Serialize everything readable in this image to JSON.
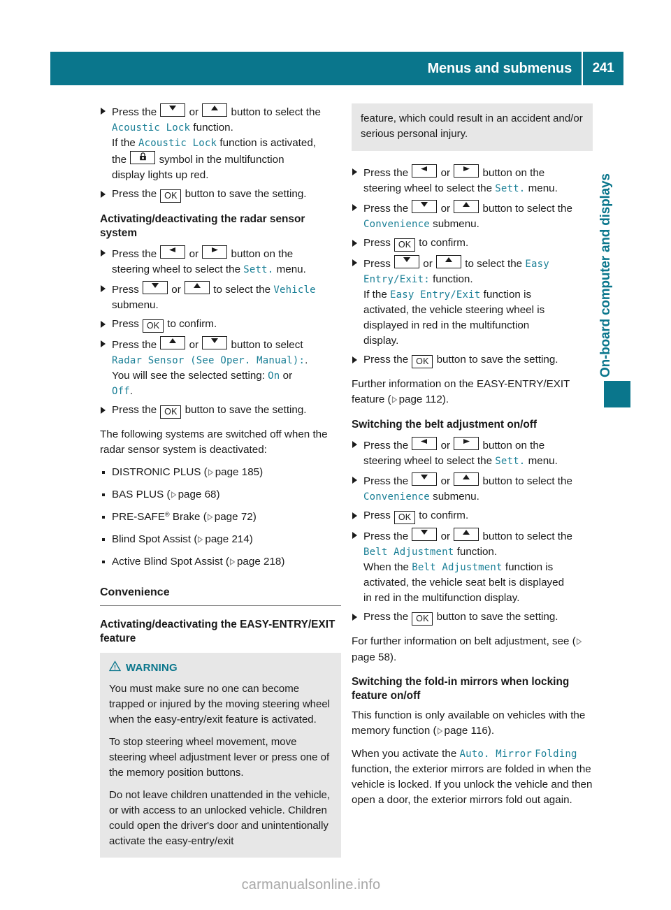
{
  "header": {
    "title": "Menus and submenus",
    "page_number": "241",
    "accent_color": "#0a768c"
  },
  "side_tab": {
    "label": "On-board computer and displays",
    "color": "#0a768c"
  },
  "keys": {
    "down": "down-arrow",
    "up": "up-arrow",
    "left": "left-arrow",
    "right": "right-arrow",
    "ok": "OK",
    "lock": "lock-symbol"
  },
  "left_column": {
    "step_acoustic": {
      "l1_a": "Press the ",
      "l1_or": " or ",
      "l1_b": " button to select the",
      "l2_fn": "Acoustic Lock",
      "l2_tail": " function.",
      "l3_a": "If the ",
      "l3_fn": "Acoustic Lock",
      "l3_tail": " function is activated,",
      "l4_a": "the ",
      "l4_tail": " symbol in the multifunction",
      "l5": "display lights up red."
    },
    "step_save_1": {
      "a": "Press the ",
      "b": " button to save the setting."
    },
    "radar_heading": "Activating/deactivating the radar sensor system",
    "step_radar_1": {
      "a": "Press the ",
      "or": " or ",
      "b": " button on the",
      "l2_a": "steering wheel to select the ",
      "l2_fn": "Sett.",
      "l2_tail": " menu."
    },
    "step_radar_2": {
      "a": "Press ",
      "or": " or ",
      "b": " to select the ",
      "fn": "Vehicle",
      "l2": "submenu."
    },
    "step_radar_3": {
      "a": "Press ",
      "b": " to confirm."
    },
    "step_radar_4": {
      "a": "Press the ",
      "or": " or ",
      "b": " button to select",
      "l2_fn": "Radar Sensor (See Oper. Manual):",
      "l2_tail": ".",
      "l3_a": "You will see the selected setting: ",
      "l3_on": "On",
      "l3_mid": " or",
      "l4_off": "Off",
      "l4_tail": "."
    },
    "step_radar_5": {
      "a": "Press the ",
      "b": " button to save the setting."
    },
    "radar_note": "The following systems are switched off when the radar sensor system is deactivated:",
    "systems_list": [
      {
        "name": "DISTRONIC PLUS",
        "page_prefix": "page",
        "page": "185"
      },
      {
        "name": "BAS PLUS",
        "page_prefix": "page",
        "page": "68"
      },
      {
        "name": "PRE-SAFE® Brake",
        "page_prefix": "page",
        "page": "72",
        "has_sup": true,
        "base": "PRE-SAFE",
        "sup": "®",
        "after": " Brake"
      },
      {
        "name": "Blind Spot Assist",
        "page_prefix": "page",
        "page": "214"
      },
      {
        "name": "Active Blind Spot Assist",
        "page_prefix": "page",
        "page": "218"
      }
    ],
    "convenience_heading": "Convenience",
    "easy_entry_heading": "Activating/deactivating the EASY-ENTRY/EXIT feature",
    "warning": {
      "title": "WARNING",
      "icon": "warning-triangle-icon",
      "paragraphs": [
        "You must make sure no one can become trapped or injured by the moving steering wheel when the easy-entry/exit feature is activated.",
        "To stop steering wheel movement, move steering wheel adjustment lever or press one of the memory position buttons.",
        "Do not leave children unattended in the vehicle, or with access to an unlocked vehicle. Children could open the driver's door and unintentionally activate the easy-entry/exit"
      ]
    }
  },
  "right_column": {
    "warning_continued": "feature, which could result in an accident and/or serious personal injury.",
    "step_ee_1": {
      "a": "Press the ",
      "or": " or ",
      "b": " button on the",
      "l2_a": "steering wheel to select the ",
      "l2_fn": "Sett.",
      "l2_tail": " menu."
    },
    "step_ee_2": {
      "a": "Press the ",
      "or": " or ",
      "b": " button to select the",
      "fn": "Convenience",
      "tail": " submenu."
    },
    "step_ee_3": {
      "a": "Press ",
      "b": " to confirm."
    },
    "step_ee_4": {
      "a": "Press ",
      "or": " or ",
      "b": " to select the ",
      "fn1": "Easy",
      "fn2": "Entry/Exit:",
      "tail": " function.",
      "l3_a": "If the ",
      "l3_fn": "Easy Entry/Exit",
      "l3_tail": " function is",
      "l4": "activated, the vehicle steering wheel is",
      "l5": "displayed in red in the multifunction",
      "l6": "display."
    },
    "step_ee_5": {
      "a": "Press the ",
      "b": " button to save the setting."
    },
    "ee_note_a": "Further information on the EASY-ENTRY/EXIT feature (",
    "ee_note_page": "page 112",
    "ee_note_b": ").",
    "belt_heading": "Switching the belt adjustment on/off",
    "step_belt_1": {
      "a": "Press the ",
      "or": " or ",
      "b": " button on the",
      "l2_a": "steering wheel to select the ",
      "l2_fn": "Sett.",
      "l2_tail": " menu."
    },
    "step_belt_2": {
      "a": "Press the ",
      "or": " or ",
      "b": " button to select the",
      "fn": "Convenience",
      "tail": " submenu."
    },
    "step_belt_3": {
      "a": "Press ",
      "b": " to confirm."
    },
    "step_belt_4": {
      "a": "Press the ",
      "or": " or ",
      "b": " button to select the",
      "fn": "Belt Adjustment",
      "tail": " function.",
      "l3_a": "When the ",
      "l3_fn": "Belt Adjustment",
      "l3_tail": " function is",
      "l4": "activated, the vehicle seat belt is displayed",
      "l5": "in red in the multifunction display."
    },
    "step_belt_5": {
      "a": "Press the ",
      "b": " button to save the setting."
    },
    "belt_note_a": "For further information on belt adjustment, see (",
    "belt_note_page": "page 58",
    "belt_note_b": ").",
    "mirror_heading": "Switching the fold-in mirrors when locking feature on/off",
    "mirror_note_a": "This function is only available on vehicles with the memory function (",
    "mirror_note_page": "page 116",
    "mirror_note_b": ").",
    "mirror_para_a": "When you activate the ",
    "mirror_fn1": "Auto. Mirror",
    "mirror_fn2": "Folding",
    "mirror_para_b": " function, the exterior mirrors are folded in when the vehicle is locked. If you unlock the vehicle and then open a door, the exterior mirrors fold out again."
  },
  "watermark": "carmanualsonline.info"
}
